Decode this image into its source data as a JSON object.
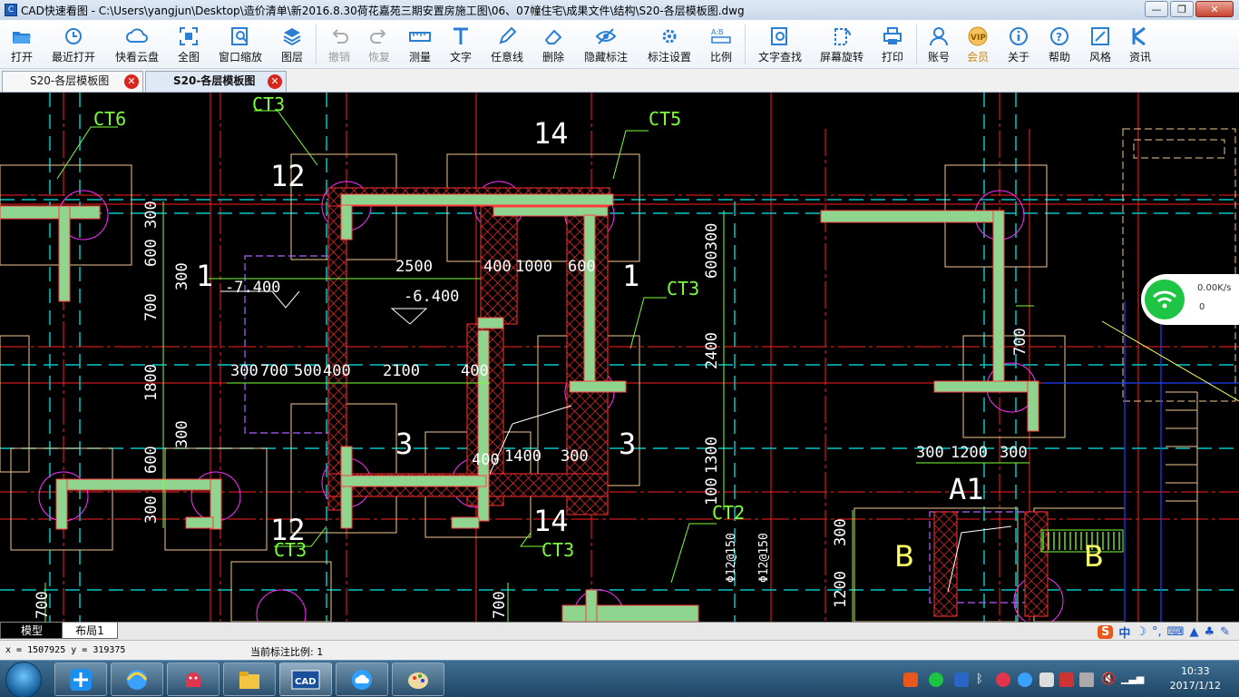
{
  "window": {
    "title": "CAD快速看图 - C:\\Users\\yangjun\\Desktop\\造价清单\\新2016.8.30荷花嘉苑三期安置房施工图\\06、07幢住宅\\成果文件\\结构\\S20-各层模板图.dwg",
    "minimize": "—",
    "maximize": "❐",
    "close": "✕"
  },
  "toolbar": [
    {
      "label": "打开",
      "icon": "folder-open-icon"
    },
    {
      "label": "最近打开",
      "icon": "clock-icon"
    },
    {
      "label": "快看云盘",
      "icon": "cloud-icon"
    },
    {
      "label": "全图",
      "icon": "fit-all-icon"
    },
    {
      "label": "窗口缩放",
      "icon": "window-zoom-icon"
    },
    {
      "label": "图层",
      "icon": "layers-icon"
    },
    {
      "label": "撤销",
      "icon": "undo-icon",
      "disabled": true
    },
    {
      "label": "恢复",
      "icon": "redo-icon",
      "disabled": true
    },
    {
      "label": "测量",
      "icon": "ruler-icon"
    },
    {
      "label": "文字",
      "icon": "text-icon"
    },
    {
      "label": "任意线",
      "icon": "pencil-icon"
    },
    {
      "label": "删除",
      "icon": "eraser-icon"
    },
    {
      "label": "隐藏标注",
      "icon": "eye-hide-icon"
    },
    {
      "label": "标注设置",
      "icon": "annotation-settings-icon"
    },
    {
      "label": "比例",
      "icon": "scale-icon"
    },
    {
      "label": "文字查找",
      "icon": "text-search-icon"
    },
    {
      "label": "屏幕旋转",
      "icon": "rotate-screen-icon"
    },
    {
      "label": "打印",
      "icon": "printer-icon"
    },
    {
      "label": "账号",
      "icon": "user-icon"
    },
    {
      "label": "会员",
      "icon": "vip-icon"
    },
    {
      "label": "关于",
      "icon": "info-icon"
    },
    {
      "label": "帮助",
      "icon": "help-icon"
    },
    {
      "label": "风格",
      "icon": "style-icon"
    },
    {
      "label": "资讯",
      "icon": "news-icon"
    }
  ],
  "tabs": [
    {
      "label": "S20-各层模板图",
      "active": false
    },
    {
      "label": "S20-各层模板图",
      "active": true
    }
  ],
  "drawing": {
    "labels": {
      "ct6": "CT6",
      "ct3_top": "CT3",
      "ct5": "CT5",
      "ct3_right": "CT3",
      "ct3_bl": "CT3",
      "ct3_bm": "CT3",
      "ct2": "CT2",
      "axis_14_top": "14",
      "axis_12_top": "12",
      "axis_12_bot": "12",
      "axis_14_bot": "14",
      "axis_1_left": "1",
      "axis_1_right": "1",
      "axis_3_left": "3",
      "axis_3_right": "3",
      "axis_a1": "A1",
      "axis_b_left": "B",
      "axis_b_right": "B"
    },
    "dims": {
      "d2500": "2500",
      "d400a": "400",
      "d1000": "1000",
      "d600a": "600",
      "d300a": "300",
      "d700": "700",
      "d500": "500",
      "d400b": "400",
      "d2100": "2100",
      "d400c": "400",
      "d400d": "400",
      "d1400": "1400",
      "d300b": "300",
      "elev1": "-7.400",
      "elev2": "-6.400",
      "v300a": "300",
      "v600a": "600",
      "v300b": "300",
      "v700": "700",
      "v1800": "1800",
      "v300c": "300",
      "v600b": "600",
      "v300d": "300",
      "v600300": "600300",
      "v2400": "2400",
      "v1300": "1300",
      "v100": "100",
      "rebar1": "Φ12@150",
      "rebar2": "Φ12@150",
      "r300a": "300",
      "r1200": "1200",
      "r300b": "300",
      "r700": "700",
      "rv300": "300",
      "rv1200": "1200",
      "lv700a": "700",
      "lv700b": "700"
    }
  },
  "network_widget": {
    "speed": "0.00K/s",
    "count": "0"
  },
  "layout_tabs": [
    "模型",
    "布局1"
  ],
  "ime": {
    "brand": "S",
    "mode": "中"
  },
  "status": {
    "coords": "x = 1507925  y = 319375",
    "scale": "当前标注比例: 1"
  },
  "taskbar": {
    "apps": [
      "pin-app-icon",
      "browser-icon",
      "android-icon",
      "file-explorer-icon",
      "cad-icon",
      "cloud-app-icon",
      "paint-icon"
    ],
    "cad_label": "CAD",
    "time": "10:33",
    "date": "2017/1/12"
  },
  "colors": {
    "wall_hatch": "#ff3030",
    "wall_fill": "#8fd48f",
    "axis_red": "#ff2020",
    "dash_cyan": "#00c8c8",
    "dim_white": "#ffffff",
    "label_green": "#7cff3a",
    "magenta_circle": "#ff30ff",
    "outline_orange": "#f0c890",
    "axis_yellow": "#ffff66"
  }
}
